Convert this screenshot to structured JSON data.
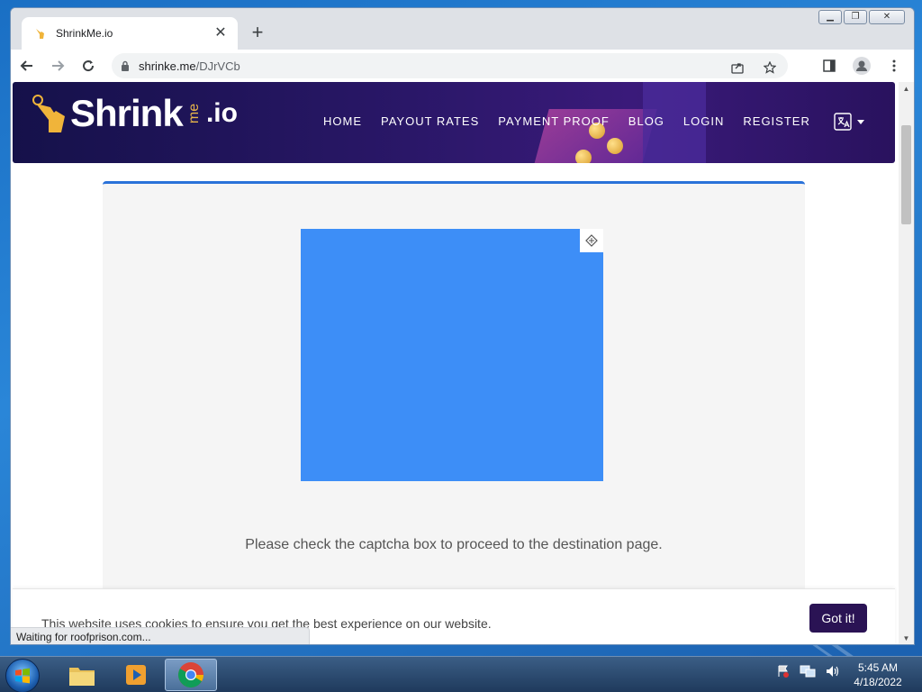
{
  "browser": {
    "tab_title": "ShrinkMe.io",
    "url_host": "shrinke.me",
    "url_path": "/DJrVCb"
  },
  "site": {
    "logo_text": "Shrink",
    "logo_me": "me",
    "logo_io": ".io",
    "nav": [
      "HOME",
      "PAYOUT RATES",
      "PAYMENT PROOF",
      "BLOG",
      "LOGIN",
      "REGISTER"
    ]
  },
  "main": {
    "captcha_message": "Please check the captcha box to proceed to the destination page."
  },
  "cookie": {
    "text": "This website uses cookies to ensure you get the best experience on our website.",
    "button": "Got it!"
  },
  "status": {
    "text": "Waiting for roofprison.com..."
  },
  "taskbar": {
    "time": "5:45 AM",
    "date": "4/18/2022"
  },
  "colors": {
    "header_bg": "#2a1768",
    "accent_blue": "#2a72d9",
    "captcha_blue": "#3d8ef7",
    "cookie_btn": "#2a1354"
  }
}
